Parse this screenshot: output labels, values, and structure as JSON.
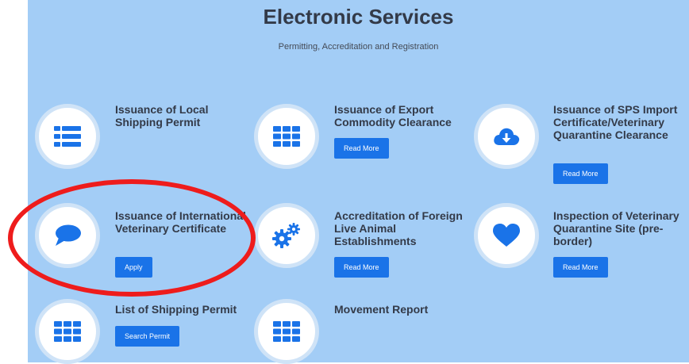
{
  "header": {
    "title": "Electronic Services",
    "subtitle": "Permitting, Accreditation and Registration"
  },
  "services": [
    {
      "title": "Issuance of Local Shipping Permit",
      "icon": "list-icon",
      "button": ""
    },
    {
      "title": "Issuance of Export Commodity Clearance",
      "icon": "grid-icon",
      "button": "Read More"
    },
    {
      "title": "Issuance of SPS Import Certificate/Veterinary Quarantine Clearance",
      "icon": "cloud-download-icon",
      "button": "Read More"
    },
    {
      "title": "Issuance of International Veterinary Certificate",
      "icon": "chat-bubble-icon",
      "button": "Apply"
    },
    {
      "title": "Accreditation of Foreign Live Animal Establishments",
      "icon": "gears-icon",
      "button": "Read More"
    },
    {
      "title": "Inspection of Veterinary Quarantine Site (pre-border)",
      "icon": "heart-icon",
      "button": "Read More"
    },
    {
      "title": "List of Shipping Permit",
      "icon": "grid-icon",
      "button": "Search Permit"
    },
    {
      "title": "Movement Report",
      "icon": "grid-icon",
      "button": ""
    }
  ],
  "annotation": {
    "color": "#ee1c1c",
    "target": "Issuance of International Veterinary Certificate"
  }
}
